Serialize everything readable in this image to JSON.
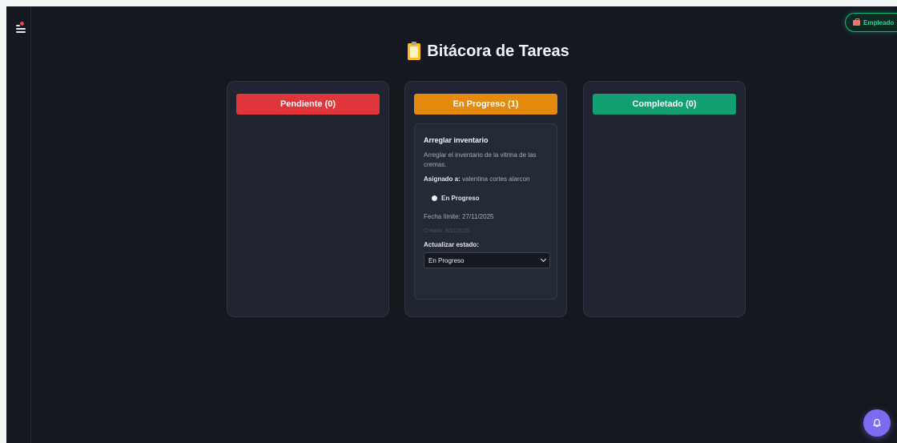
{
  "header": {
    "title": "Bitácora de Tareas",
    "title_icon": "clipboard-icon",
    "role_badge": "Empleado",
    "role_icon": "briefcase-icon"
  },
  "sidebar": {
    "menu_icon": "menu-icon",
    "notification_indicator": true
  },
  "columns": [
    {
      "label": "Pendiente (0)",
      "color": "#e0353a",
      "count": 0
    },
    {
      "label": "En Progreso (1)",
      "color": "#e58a0c",
      "count": 1
    },
    {
      "label": "Completado (0)",
      "color": "#12a073",
      "count": 0
    }
  ],
  "task": {
    "title": "Arreglar inventario",
    "description": "Arreglar el inventario de la vitrina de las cremas.",
    "assigned_label": "Asignado a:",
    "assigned_to": "valentina cortes alarcon",
    "status": "En Progreso",
    "due": "Fecha límite: 27/11/2025",
    "created": "Creado: 9/11/2025",
    "update_label": "Actualizar estado:",
    "update_value": "En Progreso"
  },
  "fab": {
    "icon": "bell-icon",
    "color": "#7c6cf0"
  }
}
